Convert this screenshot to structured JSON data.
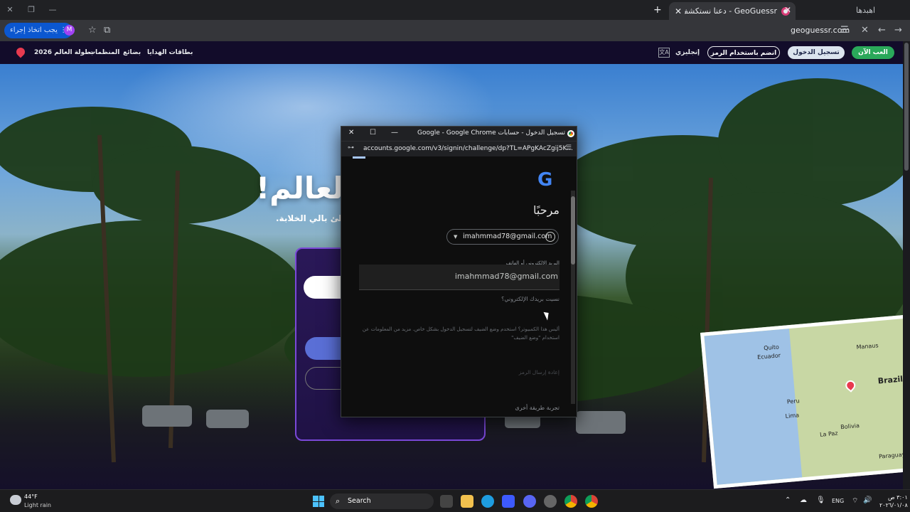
{
  "browser": {
    "tab_title": "GeoGuessr - دعنا نستكشف العالم",
    "tab_search_label": "اهبدها",
    "url": "geoguessr.com",
    "extension_button": "يجب اتخاذ إجراء",
    "profile_initial": "M"
  },
  "site": {
    "nav": [
      "بطولة العالم 2026",
      "المنظمات",
      "بضائع",
      "بطاقات الهدايا"
    ],
    "language": "إنجليزي",
    "join_button": "انضم باستخدام الرمز",
    "login_button": "تسجيل الدخول",
    "play_button": "العب الآن",
    "hero_title": "العالم!",
    "hero_subtitle": "شواطئ بالي الخلابة."
  },
  "map": {
    "labels": [
      "Quito",
      "Ecuador",
      "Manaus",
      "Brazil",
      "Peru",
      "Lima",
      "Bolivia",
      "La Paz",
      "Paraguay"
    ]
  },
  "popup": {
    "window_title": "تسجيل الدخول - حسابات Google - Google Chrome",
    "url": "accounts.google.com/v3/signin/challenge/dp?TL=APgKAcZgij5K...",
    "google_logo": "G",
    "welcome": "مرحبًا",
    "account_email": "imahmmad78@gmail.com",
    "field_label": "البريد الإلكتروني أو الهاتف",
    "field_value": "imahmmad78@gmail.com",
    "forgot_email": "نسيت بريدك الإلكتروني؟",
    "guest_mode": "أليس هذا الكمبيوتر؟ استخدم وضع الضيف لتسجيل الدخول بشكل خاص. مزيد من المعلومات عن استخدام \"وضع الضيف\"",
    "resend": "إعادة إرسال الرمز",
    "try_another": "تجربة طريقة أخرى"
  },
  "taskbar": {
    "temperature": "44°F",
    "weather": "Light rain",
    "search_placeholder": "Search",
    "language": "ENG",
    "time": "٣:٠١ ص",
    "date": "٢٠٢٦/٠١/٠٨"
  }
}
